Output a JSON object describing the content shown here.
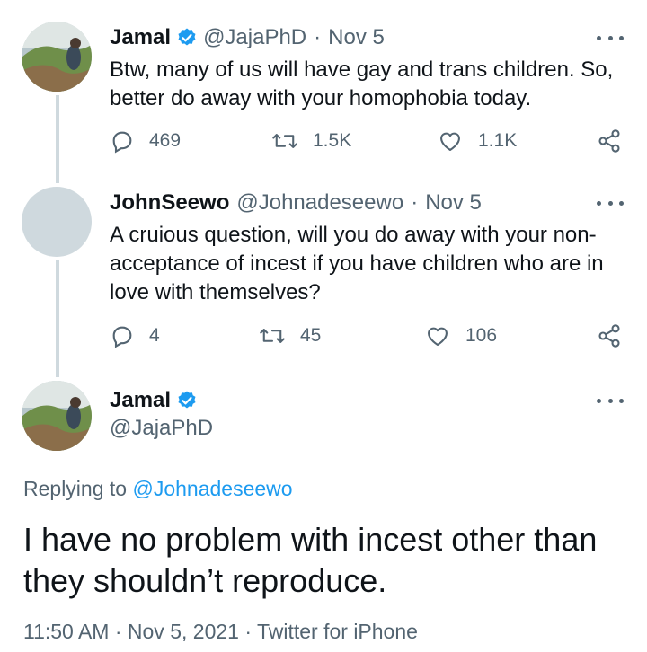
{
  "tweet1": {
    "name": "Jamal",
    "handle": "@JajaPhD",
    "separator": "·",
    "date": "Nov 5",
    "text": "Btw, many of us will have gay and trans children. So, better do away with your homophobia today.",
    "replies": "469",
    "retweets": "1.5K",
    "likes": "1.1K"
  },
  "tweet2": {
    "name": "JohnSeewo",
    "handle": "@Johnadeseewo",
    "separator": "·",
    "date": "Nov 5",
    "text": "A cruious question, will you do away with your non-acceptance of incest if you have children who are in love with themselves?",
    "replies": "4",
    "retweets": "45",
    "likes": "106"
  },
  "main": {
    "name": "Jamal",
    "handle": "@JajaPhD",
    "replying_prefix": "Replying to",
    "replying_to": "@Johnadeseewo",
    "text": "I have no problem with incest other than they shouldn’t reproduce.",
    "meta": "11:50 AM · Nov 5, 2021 · Twitter for iPhone"
  },
  "colors": {
    "accent": "#1d9bf0",
    "secondary_text": "#536471",
    "thread_line": "#cfd9de"
  }
}
